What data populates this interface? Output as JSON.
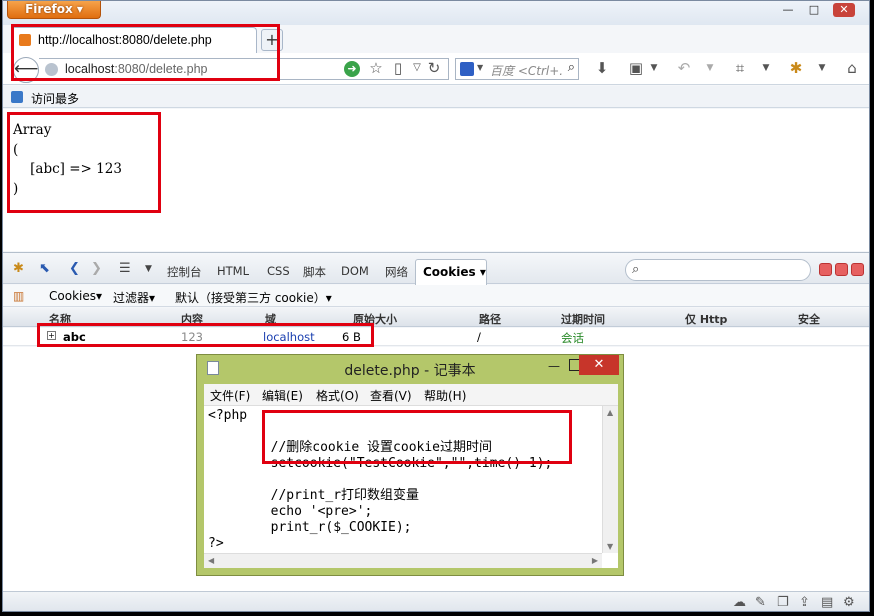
{
  "browser": {
    "app_button": "Firefox ▾",
    "tab_title": "http://localhost:8080/delete.php",
    "url_host": "localhost",
    "url_rest": ":8080/delete.php",
    "search_placeholder": "百度 <Ctrl+.",
    "bookmark": "访问最多"
  },
  "page": {
    "output": "Array\n(\n    [abc] => 123\n)"
  },
  "firebug": {
    "tabs": [
      "控制台",
      "HTML",
      "CSS",
      "脚本",
      "DOM",
      "网络"
    ],
    "active_tab": "Cookies ▾",
    "cookie_menu": "Cookies▾",
    "filter_menu": "过滤器▾",
    "default_menu": "默认（接受第三方 cookie）▾",
    "columns": [
      "名称",
      "内容",
      "域",
      "原始大小",
      "路径",
      "过期时间",
      "仅 Http",
      "安全"
    ],
    "row": {
      "name": "abc",
      "content": "123",
      "domain": "localhost",
      "size": "6 B",
      "path": "/",
      "expires": "会话"
    }
  },
  "notepad": {
    "title": "delete.php - 记事本",
    "menu": [
      "文件(F)",
      "编辑(E)",
      "格式(O)",
      "查看(V)",
      "帮助(H)"
    ],
    "code": "<?php\n\n        //删除cookie 设置cookie过期时间\n        setcookie(\"TestCookie\",\"\",time()-1);\n\n        //print_r打印数组变量\n        echo '<pre>';\n        print_r($_COOKIE);\n?>"
  },
  "colors": {
    "highlight_box": "#e00010",
    "firefox_orange": "#e06e10",
    "notepad_frame": "#b4c76a",
    "domain_link": "#1a3fb0",
    "session_green": "#2a8a2a"
  }
}
